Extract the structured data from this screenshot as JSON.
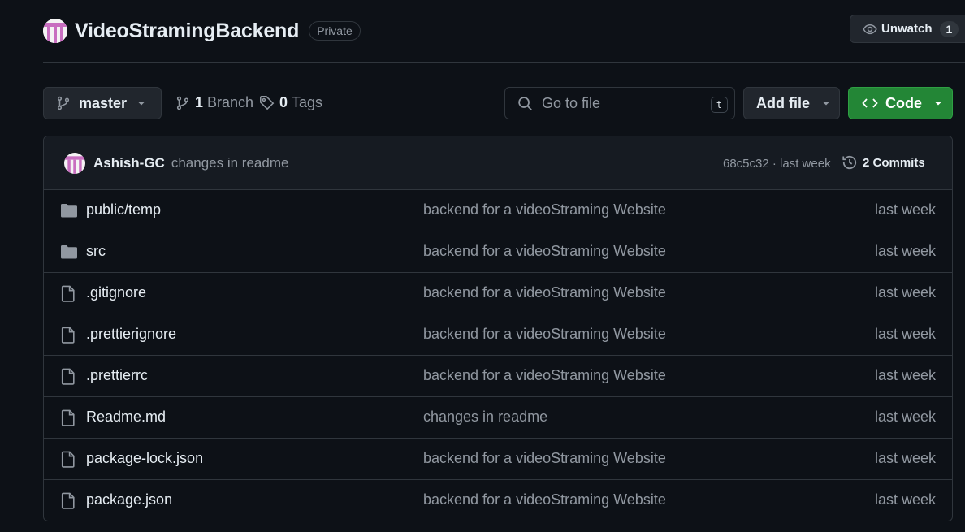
{
  "repo": {
    "name": "VideoStramingBackend",
    "visibility": "Private",
    "watch_label": "Unwatch",
    "watch_count": "1"
  },
  "toolbar": {
    "branch": "master",
    "branches_count": "1",
    "branches_label": "Branch",
    "tags_count": "0",
    "tags_label": "Tags",
    "search_placeholder": "Go to file",
    "search_shortcut": "t",
    "add_file_label": "Add file",
    "code_label": "Code"
  },
  "latest_commit": {
    "author": "Ashish-GC",
    "message": "changes in readme",
    "meta": "68c5c32 · last week",
    "commits_label": "2 Commits"
  },
  "files": [
    {
      "name": "public/temp",
      "type": "folder",
      "message": "backend for a videoStraming Website",
      "time": "last week"
    },
    {
      "name": "src",
      "type": "folder",
      "message": "backend for a videoStraming Website",
      "time": "last week"
    },
    {
      "name": ".gitignore",
      "type": "file",
      "message": "backend for a videoStraming Website",
      "time": "last week"
    },
    {
      "name": ".prettierignore",
      "type": "file",
      "message": "backend for a videoStraming Website",
      "time": "last week"
    },
    {
      "name": ".prettierrc",
      "type": "file",
      "message": "backend for a videoStraming Website",
      "time": "last week"
    },
    {
      "name": "Readme.md",
      "type": "file",
      "message": "changes in readme",
      "time": "last week"
    },
    {
      "name": "package-lock.json",
      "type": "file",
      "message": "backend for a videoStraming Website",
      "time": "last week"
    },
    {
      "name": "package.json",
      "type": "file",
      "message": "backend for a videoStraming Website",
      "time": "last week"
    }
  ],
  "colors": {
    "background": "#0d1117",
    "panel": "#161b22",
    "border": "#30363d",
    "primary_button": "#238636",
    "muted_text": "#9198a1",
    "avatar_stripe": "#c86fc0"
  },
  "icons": {
    "folder": "folder-icon",
    "file": "file-icon"
  }
}
